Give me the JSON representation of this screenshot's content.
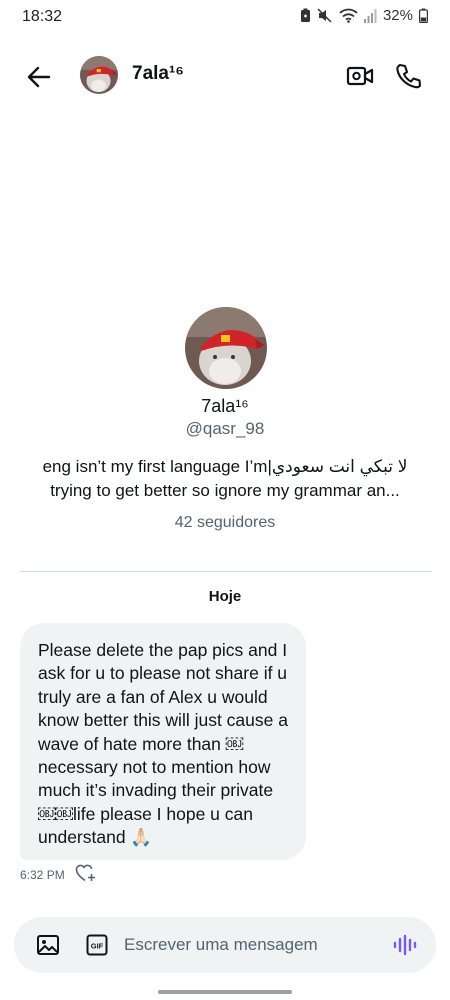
{
  "status_bar": {
    "time": "18:32",
    "battery": "32%",
    "icons": [
      "battery-saver-icon",
      "mute-icon",
      "wifi-icon",
      "signal-icon",
      "battery-icon"
    ]
  },
  "header": {
    "name": "7ala¹⁶",
    "icons": [
      "back-arrow-icon",
      "video-call-icon",
      "phone-icon"
    ]
  },
  "profile": {
    "name": "7ala¹⁶",
    "handle": "@qasr_98",
    "bio_line1": "eng isn’t my first language I’m|لا تبكي انت سعودي",
    "bio_line2": "trying to get better so ignore my grammar an...",
    "followers": "42 seguidores"
  },
  "conversation": {
    "date_label": "Hoje",
    "message": {
      "text": "Please delete the pap pics and I ask for u to please not share if u truly are a fan of Alex u would know better this will just cause a wave of hate more than ￼ necessary not to mention how much it’s invading their private ￼￼life please I hope u can understand 🙏🏻",
      "time": "6:32 PM"
    }
  },
  "composer": {
    "placeholder": "Escrever uma mensagem",
    "gif_label": "GIF",
    "icons": [
      "image-icon",
      "gif-icon",
      "voice-message-icon"
    ]
  },
  "colors": {
    "text": "#0f1419",
    "secondary": "#536471",
    "bubble": "#eff3f4",
    "accent": "#7856ff",
    "cap_red": "#d3222a"
  }
}
